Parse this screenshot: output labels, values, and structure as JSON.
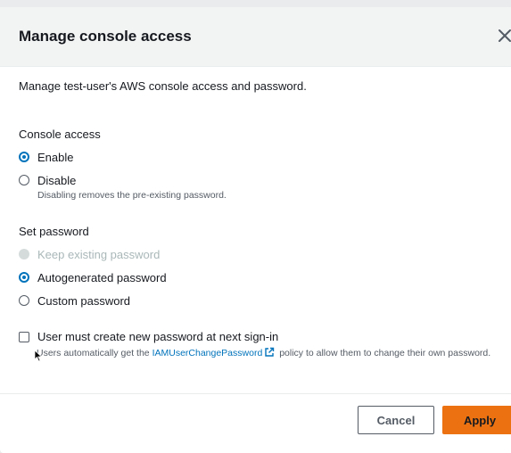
{
  "modal": {
    "title": "Manage console access",
    "intro": "Manage test-user's AWS console access and password."
  },
  "console_access": {
    "label": "Console access",
    "options": [
      {
        "label": "Enable",
        "checked": true
      },
      {
        "label": "Disable",
        "checked": false,
        "hint": "Disabling removes the pre-existing password."
      }
    ]
  },
  "set_password": {
    "label": "Set password",
    "options": [
      {
        "label": "Keep existing password",
        "checked": false,
        "disabled": true
      },
      {
        "label": "Autogenerated password",
        "checked": true
      },
      {
        "label": "Custom password",
        "checked": false
      }
    ]
  },
  "reset_required": {
    "label": "User must create new password at next sign-in",
    "checked": false,
    "desc_prefix": "Users automatically get the ",
    "link_text": "IAMUserChangePassword",
    "desc_suffix": " policy to allow them to change their own password."
  },
  "footer": {
    "cancel_label": "Cancel",
    "apply_label": "Apply"
  },
  "colors": {
    "accent": "#0073bb",
    "primary_button": "#ec7211"
  },
  "icons": [
    "close-icon",
    "external-link-icon",
    "mouse-cursor-icon"
  ]
}
